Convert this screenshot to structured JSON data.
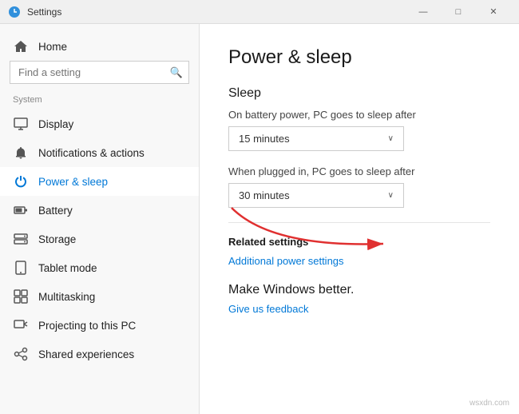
{
  "titlebar": {
    "title": "Settings",
    "minimize_label": "—",
    "maximize_label": "□",
    "close_label": "✕"
  },
  "sidebar": {
    "search_placeholder": "Find a setting",
    "section_label": "System",
    "items": [
      {
        "id": "home",
        "label": "Home",
        "icon": "⌂"
      },
      {
        "id": "display",
        "label": "Display",
        "icon": "🖥"
      },
      {
        "id": "notifications",
        "label": "Notifications & actions",
        "icon": "🔔"
      },
      {
        "id": "power",
        "label": "Power & sleep",
        "icon": "⏻",
        "active": true
      },
      {
        "id": "battery",
        "label": "Battery",
        "icon": "🔋"
      },
      {
        "id": "storage",
        "label": "Storage",
        "icon": "💾"
      },
      {
        "id": "tablet",
        "label": "Tablet mode",
        "icon": "📱"
      },
      {
        "id": "multitasking",
        "label": "Multitasking",
        "icon": "⧉"
      },
      {
        "id": "projecting",
        "label": "Projecting to this PC",
        "icon": "📽"
      },
      {
        "id": "shared",
        "label": "Shared experiences",
        "icon": "🔗"
      }
    ]
  },
  "content": {
    "page_title": "Power & sleep",
    "sleep_section": {
      "title": "Sleep",
      "battery_label": "On battery power, PC goes to sleep after",
      "battery_value": "15 minutes",
      "plugged_label": "When plugged in, PC goes to sleep after",
      "plugged_value": "30 minutes"
    },
    "related_settings": {
      "title": "Related settings",
      "link_text": "Additional power settings"
    },
    "make_better": {
      "title": "Make Windows better.",
      "link_text": "Give us feedback"
    }
  },
  "watermark": "wsxdn.com"
}
